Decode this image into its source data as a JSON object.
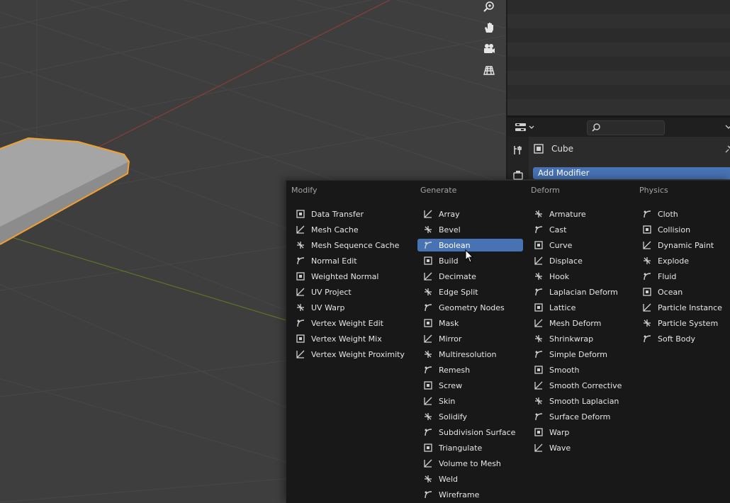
{
  "properties": {
    "object_name": "Cube",
    "add_modifier_label": "Add Modifier"
  },
  "menu": {
    "columns": [
      {
        "title": "Modify",
        "items": [
          "Data Transfer",
          "Mesh Cache",
          "Mesh Sequence Cache",
          "Normal Edit",
          "Weighted Normal",
          "UV Project",
          "UV Warp",
          "Vertex Weight Edit",
          "Vertex Weight Mix",
          "Vertex Weight Proximity"
        ]
      },
      {
        "title": "Generate",
        "items": [
          "Array",
          "Bevel",
          "Boolean",
          "Build",
          "Decimate",
          "Edge Split",
          "Geometry Nodes",
          "Mask",
          "Mirror",
          "Multiresolution",
          "Remesh",
          "Screw",
          "Skin",
          "Solidify",
          "Subdivision Surface",
          "Triangulate",
          "Volume to Mesh",
          "Weld",
          "Wireframe"
        ]
      },
      {
        "title": "Deform",
        "items": [
          "Armature",
          "Cast",
          "Curve",
          "Displace",
          "Hook",
          "Laplacian Deform",
          "Lattice",
          "Mesh Deform",
          "Shrinkwrap",
          "Simple Deform",
          "Smooth",
          "Smooth Corrective",
          "Smooth Laplacian",
          "Surface Deform",
          "Warp",
          "Wave"
        ]
      },
      {
        "title": "Physics",
        "items": [
          "Cloth",
          "Collision",
          "Dynamic Paint",
          "Explode",
          "Fluid",
          "Ocean",
          "Particle Instance",
          "Particle System",
          "Soft Body"
        ]
      }
    ],
    "highlighted_item": "Boolean"
  },
  "viewport": {
    "nav_icons": [
      "zoom-icon",
      "pan-hand-icon",
      "camera-icon",
      "grid-view-icon"
    ]
  },
  "colors": {
    "accent": "#4772b3",
    "selection_outline": "#f0a030",
    "x_axis": "#b04545",
    "y_axis": "#6e8a2c"
  }
}
